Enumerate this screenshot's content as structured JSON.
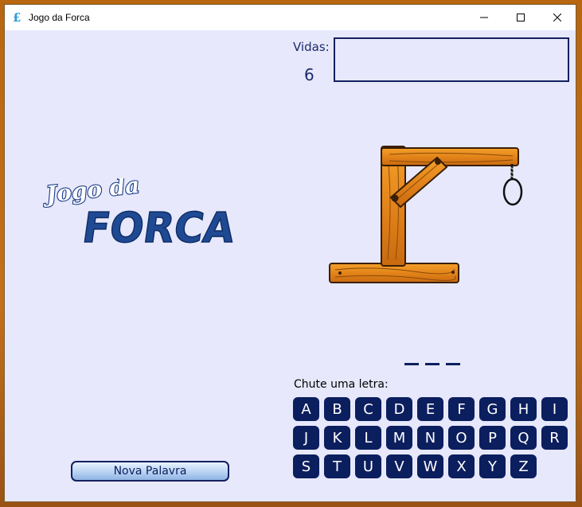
{
  "window": {
    "title": "Jogo da Forca",
    "icon_glyph": "£"
  },
  "lives": {
    "label": "Vidas:",
    "value": "6"
  },
  "wrong_letters": "",
  "logo": {
    "line1": "Jogo da",
    "line2": "FORCA"
  },
  "word": {
    "blanks": 3
  },
  "guess": {
    "label": "Chute uma letra:",
    "letters": [
      "A",
      "B",
      "C",
      "D",
      "E",
      "F",
      "G",
      "H",
      "I",
      "J",
      "K",
      "L",
      "M",
      "N",
      "O",
      "P",
      "Q",
      "R",
      "S",
      "T",
      "U",
      "V",
      "W",
      "X",
      "Y",
      "Z"
    ]
  },
  "buttons": {
    "new_word": "Nova Palavra"
  },
  "colors": {
    "background": "#e7e8fb",
    "navy": "#0b1e5e",
    "wood": "#e88a1a"
  },
  "icons": [
    "minimize-icon",
    "maximize-icon",
    "close-icon",
    "gallows-image",
    "game-logo"
  ]
}
